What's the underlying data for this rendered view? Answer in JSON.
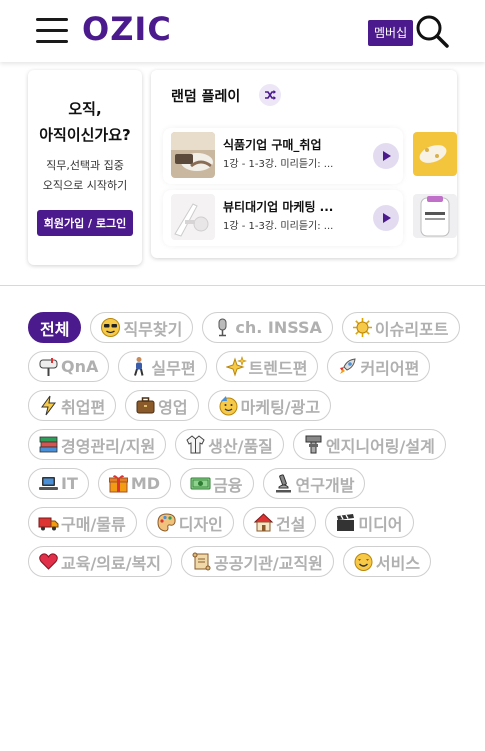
{
  "header": {
    "logo": "OZIC",
    "member_button": "멤버십",
    "brand_color": "#4b1a8c"
  },
  "login_card": {
    "title_line1": "오직,",
    "title_line2": "아직이신가요?",
    "sub_line1": "직무,선택과 집중",
    "sub_line2": "오직으로 시작하기",
    "button": "회원가입 / 로그인"
  },
  "random_play": {
    "title": "랜덤 플레이",
    "items": [
      {
        "title": "식품기업 구매_취업",
        "subtitle": "1강 - 1-3강. 미리듣기: ..."
      },
      {
        "title": "뷰티대기업 마케팅 ...",
        "subtitle": "1강 - 1-3강. 미리듣기: ..."
      }
    ]
  },
  "categories": [
    {
      "label": "전체",
      "icon": "",
      "active": true
    },
    {
      "label": "직무찾기",
      "icon": "sunglasses-smiley-icon"
    },
    {
      "label": "ch. INSSA",
      "icon": "microphone-icon"
    },
    {
      "label": "이슈리포트",
      "icon": "sun-icon"
    },
    {
      "label": "QnA",
      "icon": "mailbox-icon"
    },
    {
      "label": "실무편",
      "icon": "person-walking-icon"
    },
    {
      "label": "트렌드편",
      "icon": "sparkles-icon"
    },
    {
      "label": "커리어편",
      "icon": "rocket-icon"
    },
    {
      "label": "취업편",
      "icon": "lightning-icon"
    },
    {
      "label": "영업",
      "icon": "briefcase-icon"
    },
    {
      "label": "마케팅/광고",
      "icon": "party-face-icon"
    },
    {
      "label": "경영관리/지원",
      "icon": "books-icon"
    },
    {
      "label": "생산/품질",
      "icon": "lab-coat-icon"
    },
    {
      "label": "엔지니어링/설계",
      "icon": "tool-icon"
    },
    {
      "label": "IT",
      "icon": "laptop-icon"
    },
    {
      "label": "MD",
      "icon": "gift-icon"
    },
    {
      "label": "금융",
      "icon": "money-icon"
    },
    {
      "label": "연구개발",
      "icon": "microscope-icon"
    },
    {
      "label": "구매/물류",
      "icon": "truck-icon"
    },
    {
      "label": "디자인",
      "icon": "palette-icon"
    },
    {
      "label": "건설",
      "icon": "house-icon"
    },
    {
      "label": "미디어",
      "icon": "clapper-icon"
    },
    {
      "label": "교육/의료/복지",
      "icon": "heart-icon"
    },
    {
      "label": "공공기관/교직원",
      "icon": "scroll-icon"
    },
    {
      "label": "서비스",
      "icon": "smiling-hearts-icon"
    }
  ]
}
